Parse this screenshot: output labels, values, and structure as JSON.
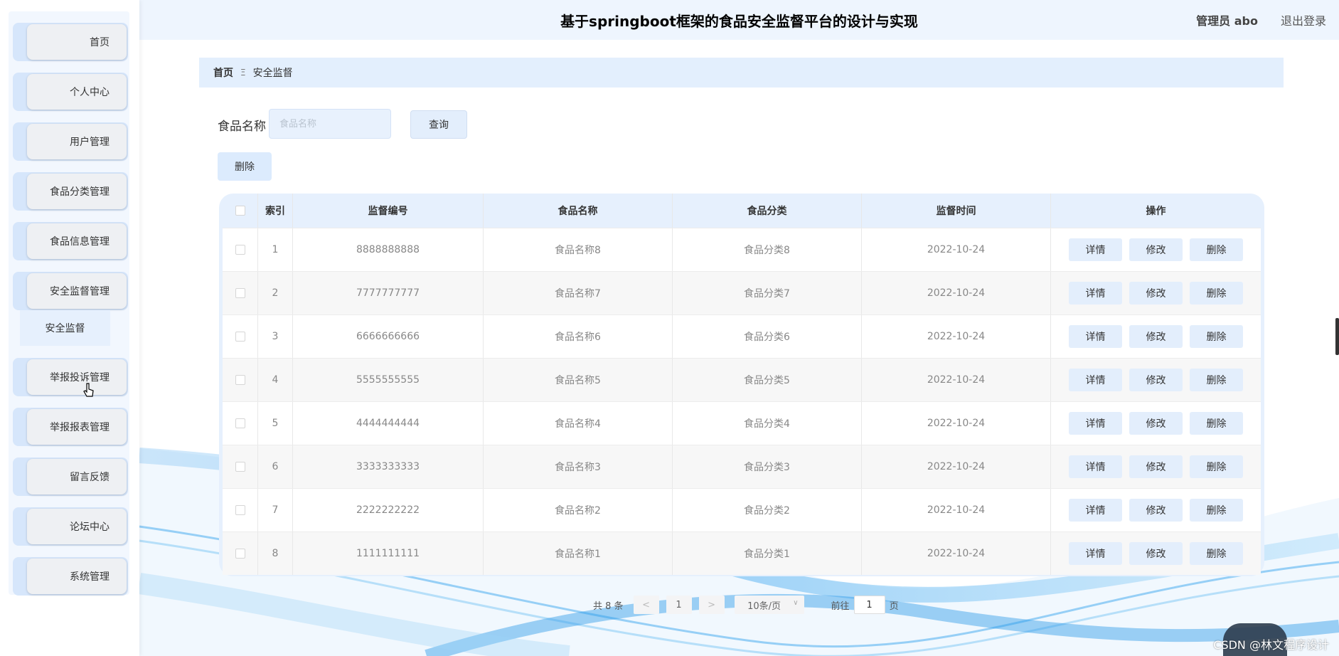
{
  "app": {
    "title": "基于springboot框架的食品安全监督平台的设计与实现",
    "user_label": "管理员 abo",
    "logout_label": "退出登录"
  },
  "sidebar": {
    "items": [
      {
        "label": "首页"
      },
      {
        "label": "个人中心"
      },
      {
        "label": "用户管理"
      },
      {
        "label": "食品分类管理"
      },
      {
        "label": "食品信息管理"
      },
      {
        "label": "安全监督管理"
      },
      {
        "label": "举报投诉管理"
      },
      {
        "label": "举报报表管理"
      },
      {
        "label": "留言反馈"
      },
      {
        "label": "论坛中心"
      },
      {
        "label": "系统管理"
      }
    ],
    "active_sub": "安全监督"
  },
  "breadcrumb": {
    "home": "首页",
    "separator": "Ξ",
    "current": "安全监督"
  },
  "search": {
    "label": "食品名称",
    "placeholder": "食品名称",
    "value": "",
    "query_button": "查询",
    "delete_button": "删除"
  },
  "table": {
    "headers": [
      "索引",
      "监督编号",
      "食品名称",
      "食品分类",
      "监督时间",
      "操作"
    ],
    "rows": [
      {
        "index": "1",
        "number": "8888888888",
        "name": "食品名称8",
        "category": "食品分类8",
        "time": "2022-10-24"
      },
      {
        "index": "2",
        "number": "7777777777",
        "name": "食品名称7",
        "category": "食品分类7",
        "time": "2022-10-24"
      },
      {
        "index": "3",
        "number": "6666666666",
        "name": "食品名称6",
        "category": "食品分类6",
        "time": "2022-10-24"
      },
      {
        "index": "4",
        "number": "5555555555",
        "name": "食品名称5",
        "category": "食品分类5",
        "time": "2022-10-24"
      },
      {
        "index": "5",
        "number": "4444444444",
        "name": "食品名称4",
        "category": "食品分类4",
        "time": "2022-10-24"
      },
      {
        "index": "6",
        "number": "3333333333",
        "name": "食品名称3",
        "category": "食品分类3",
        "time": "2022-10-24"
      },
      {
        "index": "7",
        "number": "2222222222",
        "name": "食品名称2",
        "category": "食品分类2",
        "time": "2022-10-24"
      },
      {
        "index": "8",
        "number": "1111111111",
        "name": "食品名称1",
        "category": "食品分类1",
        "time": "2022-10-24"
      }
    ],
    "ops": {
      "detail": "详情",
      "edit": "修改",
      "delete": "删除"
    }
  },
  "pagination": {
    "total": "共 8 条",
    "prev": "<",
    "page": "1",
    "next": ">",
    "page_size": "10条/页",
    "goto_prefix": "前往",
    "goto_value": "1",
    "goto_suffix": "页"
  },
  "watermark": "CSDN @林文程序设计",
  "colors": {
    "header_bg": "#eef5fe",
    "accent_light": "#e3eefc",
    "table_frame": "#e6f0fd"
  }
}
